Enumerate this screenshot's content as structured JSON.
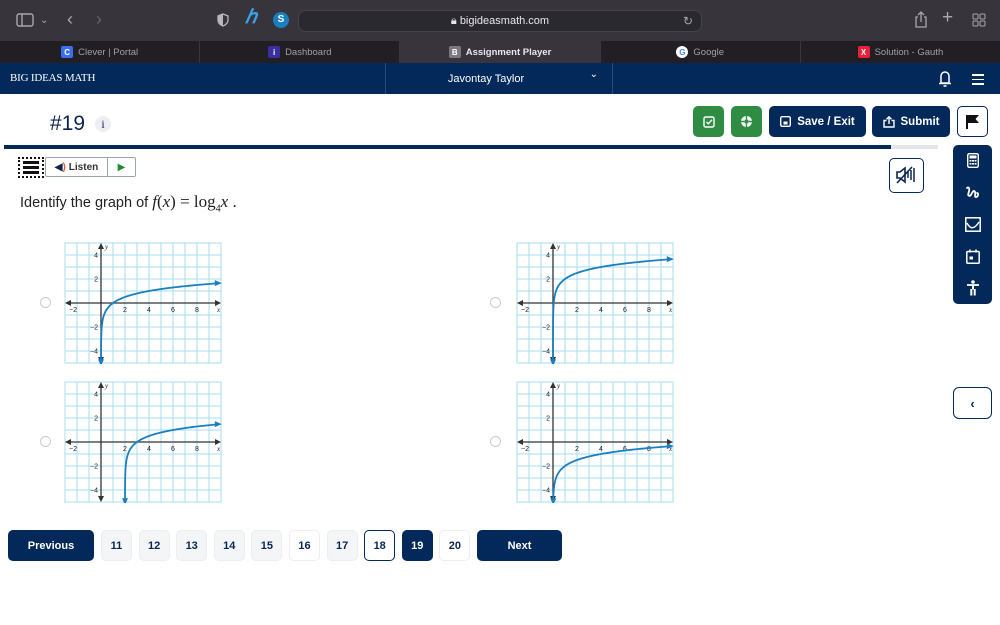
{
  "browser": {
    "url": "bigideasmath.com",
    "tabs": [
      {
        "label": "Clever | Portal",
        "favicon": "C",
        "favicon_color": "#3b6ff0",
        "active": false
      },
      {
        "label": "Dashboard",
        "favicon": "i",
        "favicon_color": "#3a2f9c",
        "active": false
      },
      {
        "label": "Assignment Player",
        "favicon": "B",
        "favicon_color": "#7b7881",
        "active": true
      },
      {
        "label": "Google",
        "favicon": "G",
        "favicon_color": "#ffffff",
        "active": false
      },
      {
        "label": "Solution - Gauth",
        "favicon": "X",
        "favicon_color": "#e8213a",
        "active": false
      }
    ]
  },
  "app": {
    "brand": "BIG IDEAS MATH",
    "user_name": "Javontay Taylor",
    "colors": {
      "navy": "#03295a",
      "green": "#2f8c43",
      "curve": "#1a7fc1",
      "grid": "#a9dcf0"
    }
  },
  "question": {
    "number": "#19",
    "info_label": "i",
    "progress_percent": 95,
    "listen_label": "Listen",
    "prompt_text": "Identify the graph of ",
    "prompt_math": {
      "f": "f",
      "open": "(",
      "x": "x",
      "close": ") = log",
      "base": "4",
      "arg": "x",
      "end": " ."
    }
  },
  "toolbar": {
    "save_exit_label": "Save / Exit",
    "submit_label": "Submit"
  },
  "options": [
    {
      "id": "A",
      "description": "y = log4(x)",
      "chart_data": {
        "type": "line",
        "xlim": [
          -3,
          10
        ],
        "ylim": [
          -5,
          5
        ],
        "xticks": [
          "-2",
          "2",
          "4",
          "6",
          "8"
        ],
        "yticks": [
          "4",
          "2",
          "-2",
          "-4"
        ],
        "xlabel": "x",
        "ylabel": "y",
        "grid": true,
        "function": "log4(x)",
        "shift_x": 0,
        "shift_y": 0
      }
    },
    {
      "id": "B",
      "description": "y = log4(x) + 2",
      "chart_data": {
        "type": "line",
        "xlim": [
          -3,
          10
        ],
        "ylim": [
          -5,
          5
        ],
        "xticks": [
          "-2",
          "2",
          "4",
          "6",
          "8"
        ],
        "yticks": [
          "4",
          "2",
          "-2",
          "-4"
        ],
        "xlabel": "x",
        "ylabel": "y",
        "grid": true,
        "function": "log4(x)",
        "shift_x": 0,
        "shift_y": 2
      }
    },
    {
      "id": "C",
      "description": "y = log4(x - 2)",
      "chart_data": {
        "type": "line",
        "xlim": [
          -3,
          10
        ],
        "ylim": [
          -5,
          5
        ],
        "xticks": [
          "-2",
          "2",
          "4",
          "6",
          "8"
        ],
        "yticks": [
          "4",
          "2",
          "-2",
          "-4"
        ],
        "xlabel": "x",
        "ylabel": "y",
        "grid": true,
        "function": "log4(x)",
        "shift_x": 2,
        "shift_y": 0
      }
    },
    {
      "id": "D",
      "description": "y = log4(x) - 2",
      "chart_data": {
        "type": "line",
        "xlim": [
          -3,
          10
        ],
        "ylim": [
          -5,
          5
        ],
        "xticks": [
          "-2",
          "2",
          "4",
          "6",
          "8"
        ],
        "yticks": [
          "4",
          "2",
          "-2",
          "-4"
        ],
        "xlabel": "x",
        "ylabel": "y",
        "grid": true,
        "function": "log4(x)",
        "shift_x": 0,
        "shift_y": -2
      }
    }
  ],
  "pagination": {
    "previous_label": "Previous",
    "next_label": "Next",
    "pages": [
      {
        "label": "11",
        "state": "gray"
      },
      {
        "label": "12",
        "state": "gray"
      },
      {
        "label": "13",
        "state": "gray"
      },
      {
        "label": "14",
        "state": "gray"
      },
      {
        "label": "15",
        "state": "gray"
      },
      {
        "label": "16",
        "state": "white"
      },
      {
        "label": "17",
        "state": "gray"
      },
      {
        "label": "18",
        "state": "outlined"
      },
      {
        "label": "19",
        "state": "current"
      },
      {
        "label": "20",
        "state": "white"
      }
    ]
  }
}
